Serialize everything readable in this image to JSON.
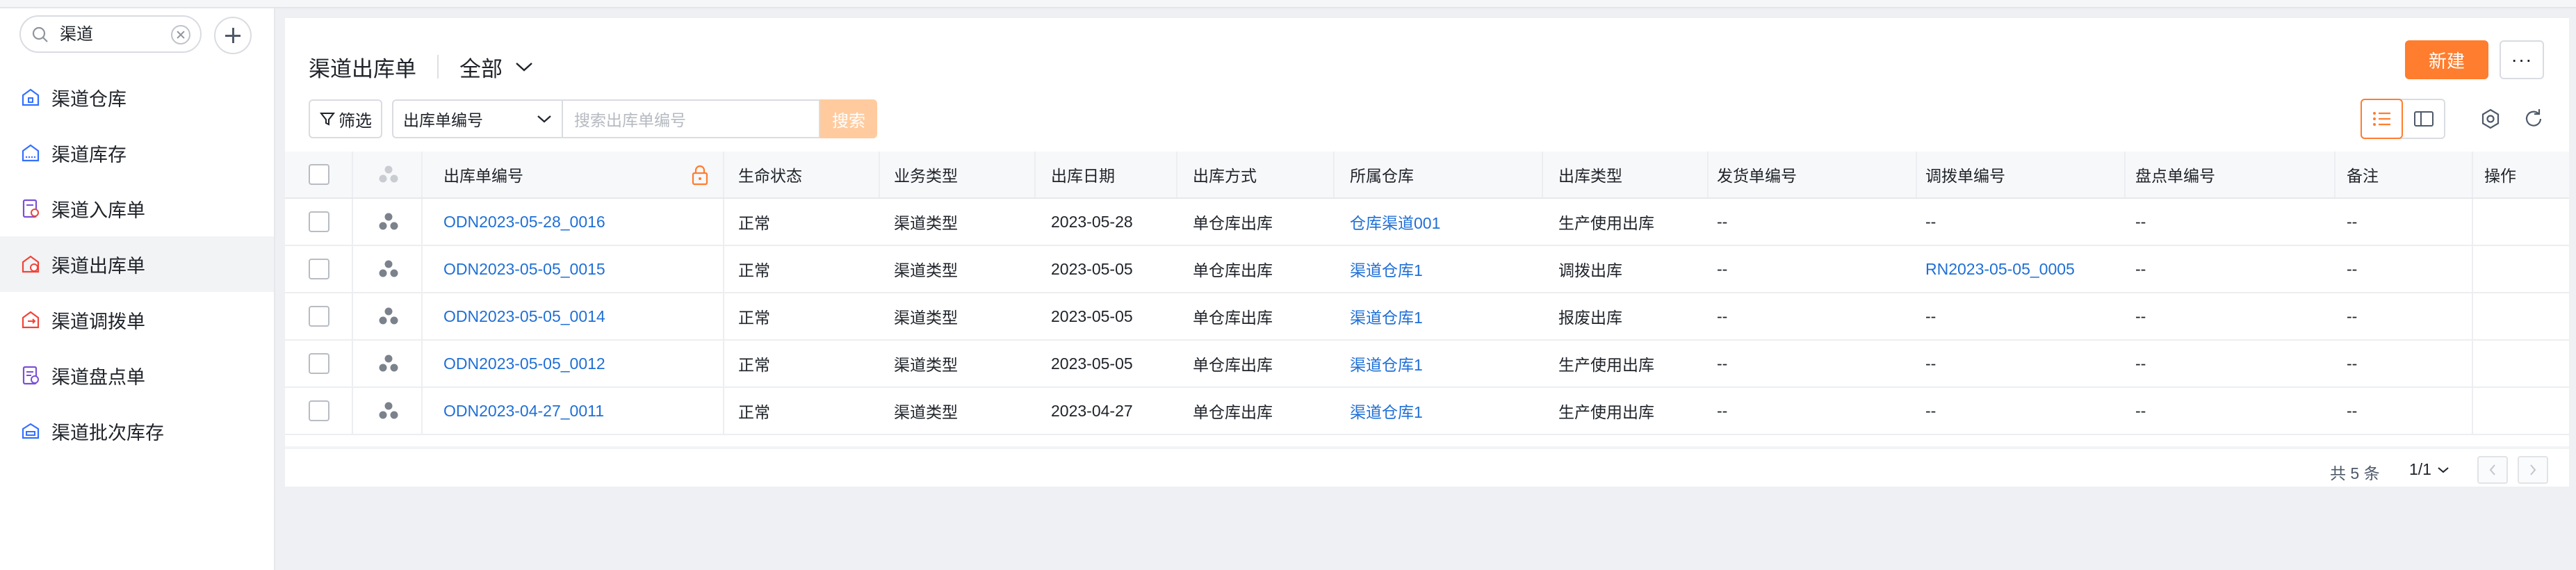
{
  "sidebar": {
    "search": {
      "value": "渠道"
    },
    "items": [
      {
        "label": "渠道仓库",
        "icon": "warehouse-icon",
        "color": "#3370ff"
      },
      {
        "label": "渠道库存",
        "icon": "inventory-icon",
        "color": "#3370ff"
      },
      {
        "label": "渠道入库单",
        "icon": "inbound-doc-icon",
        "color": "#7b4fd8"
      },
      {
        "label": "渠道出库单",
        "icon": "outbound-icon",
        "color": "#f04438",
        "active": true
      },
      {
        "label": "渠道调拨单",
        "icon": "transfer-icon",
        "color": "#f04438"
      },
      {
        "label": "渠道盘点单",
        "icon": "stocktake-doc-icon",
        "color": "#7b4fd8"
      },
      {
        "label": "渠道批次库存",
        "icon": "batch-inventory-icon",
        "color": "#3370ff"
      }
    ]
  },
  "header": {
    "title": "渠道出库单",
    "view": "全部",
    "new_label": "新建",
    "more_label": "···"
  },
  "filter": {
    "filter_label": "筛选",
    "field": "出库单编号",
    "placeholder": "搜索出库单编号",
    "search_label": "搜索"
  },
  "table": {
    "columns": [
      "出库单编号",
      "生命状态",
      "业务类型",
      "出库日期",
      "出库方式",
      "所属仓库",
      "出库类型",
      "发货单编号",
      "调拨单编号",
      "盘点单编号",
      "备注",
      "操作"
    ],
    "rows": [
      {
        "id": "ODN2023-05-28_0016",
        "status": "正常",
        "biz": "渠道类型",
        "date": "2023-05-28",
        "method": "单仓库出库",
        "warehouse": "仓库渠道001",
        "type": "生产使用出库",
        "ship": "--",
        "transfer": "--",
        "stocktake": "--",
        "note": "--"
      },
      {
        "id": "ODN2023-05-05_0015",
        "status": "正常",
        "biz": "渠道类型",
        "date": "2023-05-05",
        "method": "单仓库出库",
        "warehouse": "渠道仓库1",
        "type": "调拨出库",
        "ship": "--",
        "transfer": "RN2023-05-05_0005",
        "stocktake": "--",
        "note": "--"
      },
      {
        "id": "ODN2023-05-05_0014",
        "status": "正常",
        "biz": "渠道类型",
        "date": "2023-05-05",
        "method": "单仓库出库",
        "warehouse": "渠道仓库1",
        "type": "报废出库",
        "ship": "--",
        "transfer": "--",
        "stocktake": "--",
        "note": "--"
      },
      {
        "id": "ODN2023-05-05_0012",
        "status": "正常",
        "biz": "渠道类型",
        "date": "2023-05-05",
        "method": "单仓库出库",
        "warehouse": "渠道仓库1",
        "type": "生产使用出库",
        "ship": "--",
        "transfer": "--",
        "stocktake": "--",
        "note": "--"
      },
      {
        "id": "ODN2023-04-27_0011",
        "status": "正常",
        "biz": "渠道类型",
        "date": "2023-04-27",
        "method": "单仓库出库",
        "warehouse": "渠道仓库1",
        "type": "生产使用出库",
        "ship": "--",
        "transfer": "--",
        "stocktake": "--",
        "note": "--"
      }
    ]
  },
  "footer": {
    "total": "共 5 条",
    "page": "1/1"
  },
  "colors": {
    "accent": "#ff7d2e",
    "link": "#1f6fd6"
  }
}
